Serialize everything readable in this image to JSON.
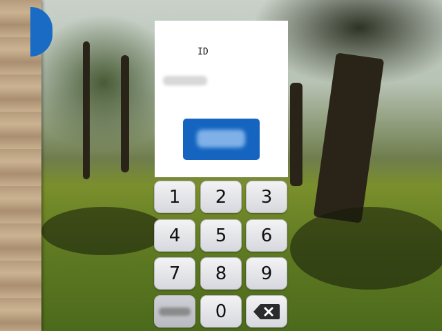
{
  "card": {
    "id_label": "ID",
    "id_value": "",
    "submit_label": ""
  },
  "keypad": {
    "keys": [
      "1",
      "2",
      "3",
      "4",
      "5",
      "6",
      "7",
      "8",
      "9",
      "",
      "0"
    ],
    "bottom_left_label": "",
    "backspace_icon": "backspace-icon"
  },
  "colors": {
    "accent": "#1565c0",
    "side_tab": "#1a6bc4",
    "card_bg": "#ffffff"
  }
}
